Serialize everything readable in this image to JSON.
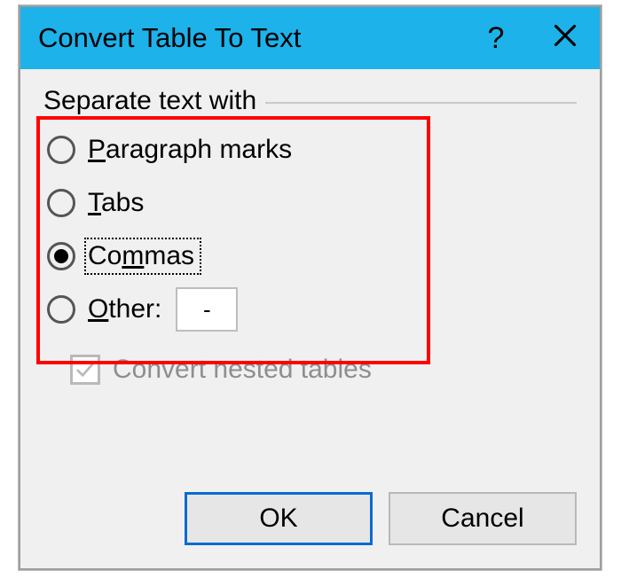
{
  "titlebar": {
    "title": "Convert Table To Text"
  },
  "group": {
    "label": "Separate text with"
  },
  "options": {
    "paragraph": {
      "label": "Paragraph marks",
      "checked": false
    },
    "tabs": {
      "label": "Tabs",
      "checked": false
    },
    "commas": {
      "label": "Commas",
      "checked": true
    },
    "other": {
      "label": "Other:",
      "checked": false,
      "value": "-"
    }
  },
  "nested": {
    "label": "Convert nested tables",
    "checked": true,
    "enabled": false
  },
  "buttons": {
    "ok": "OK",
    "cancel": "Cancel"
  },
  "annotation": {
    "color": "#ff0000"
  }
}
